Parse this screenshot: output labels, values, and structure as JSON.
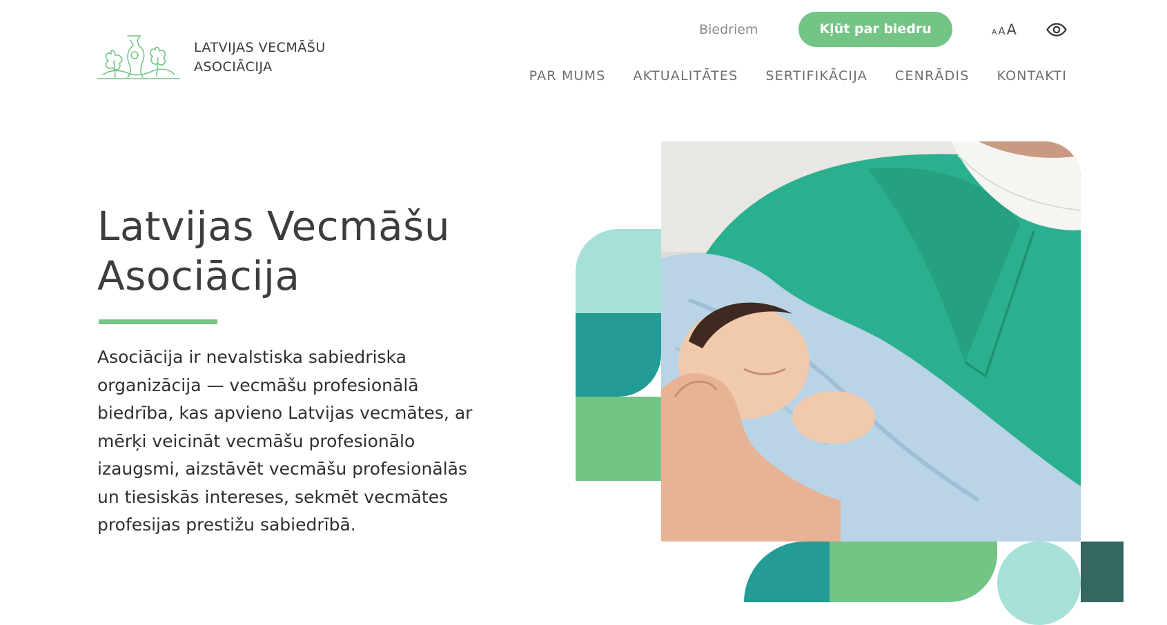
{
  "logo": {
    "line1": "LATVIJAS VECMĀŠU",
    "line2": "ASOCIĀCIJA",
    "icon": "midwife-logo-icon"
  },
  "top_links": {
    "members": "Biedriem",
    "join_button": "Kļūt par biedru",
    "font_small": "A",
    "font_medium": "A",
    "font_large": "A",
    "accessibility_icon": "eye-icon"
  },
  "nav": {
    "items": [
      {
        "label": "PAR MUMS"
      },
      {
        "label": "AKTUALITĀTES"
      },
      {
        "label": "SERTIFIKĀCIJA"
      },
      {
        "label": "CENRĀDIS"
      },
      {
        "label": "KONTAKTI"
      }
    ]
  },
  "hero": {
    "title_line1": "Latvijas Vecmāšu",
    "title_line2": "Asociācija",
    "description": "Asociācija ir nevalstiska sabiedriska organizācija — vecmāšu profesionālā biedrība, kas apvieno Latvijas vecmātes, ar mērķi veicināt vecmāšu profesionālo izaugsmi, aizstāvēt vecmāšu profesionālās un tiesiskās intereses, sekmēt vecmātes profesijas prestižu sabiedrībā."
  },
  "colors": {
    "accent_green": "#74c486",
    "teal": "#229c95",
    "mint": "#a7e0d6",
    "dark_teal": "#33675f",
    "scrubs_green": "#2bb08f"
  }
}
